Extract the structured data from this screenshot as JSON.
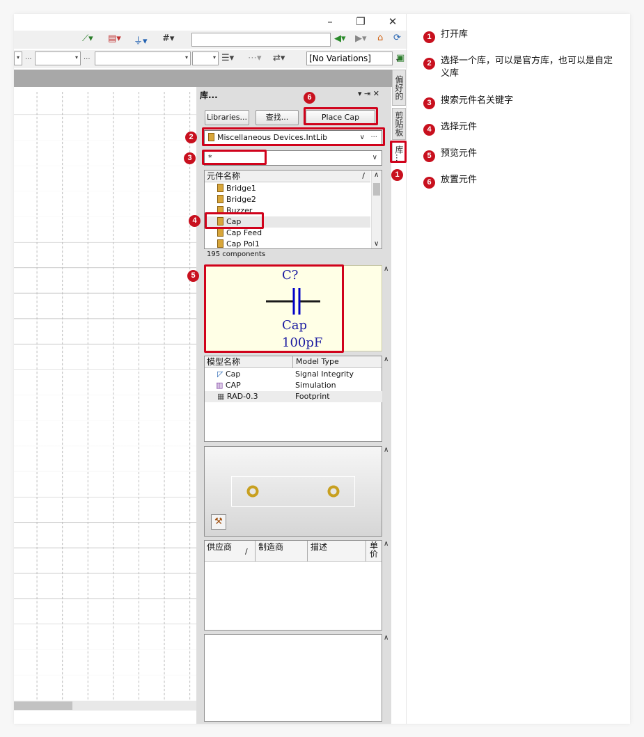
{
  "window": {
    "minimize_glyph": "–",
    "restore_glyph": "❐",
    "close_glyph": "✕"
  },
  "toolbar": {
    "variations": "[No Variations]",
    "dots": "..."
  },
  "panel": {
    "title": "库...",
    "title_controls": "▾ ⇥ ✕",
    "libraries_button": "Libraries...",
    "search_button": "查找...",
    "place_button": "Place Cap",
    "library_name": "Miscellaneous Devices.IntLib",
    "library_more": "···",
    "filter_value": "*",
    "component_header": "元件名称",
    "components": [
      "Bridge1",
      "Bridge2",
      "Buzzer",
      "Cap",
      "Cap Feed",
      "Cap Pol1"
    ],
    "component_count": "195 components",
    "preview": {
      "designator": "C?",
      "name": "Cap",
      "value": "100pF"
    },
    "model_header_name": "模型名称",
    "model_header_type": "Model Type",
    "models": [
      {
        "name": "Cap",
        "type": "Signal Integrity"
      },
      {
        "name": "CAP",
        "type": "Simulation"
      },
      {
        "name": "RAD-0.3",
        "type": "Footprint"
      }
    ],
    "supplier_headers": [
      "供应商",
      "制造商",
      "描述",
      "单价"
    ]
  },
  "side_tabs": [
    "偏好的",
    "剪贴板",
    "库..."
  ],
  "legend": [
    {
      "num": "1",
      "text": "打开库"
    },
    {
      "num": "2",
      "text": "选择一个库，可以是官方库，也可以是自定义库"
    },
    {
      "num": "3",
      "text": "搜索元件名关键字"
    },
    {
      "num": "4",
      "text": "选择元件"
    },
    {
      "num": "5",
      "text": "预览元件"
    },
    {
      "num": "6",
      "text": "放置元件"
    }
  ],
  "colors": {
    "accent_red": "#d0021b",
    "badge_red": "#c8101e",
    "preview_bg": "#ffffe6",
    "schematic_blue": "#0000c8",
    "pad_gold": "#c8a020"
  }
}
